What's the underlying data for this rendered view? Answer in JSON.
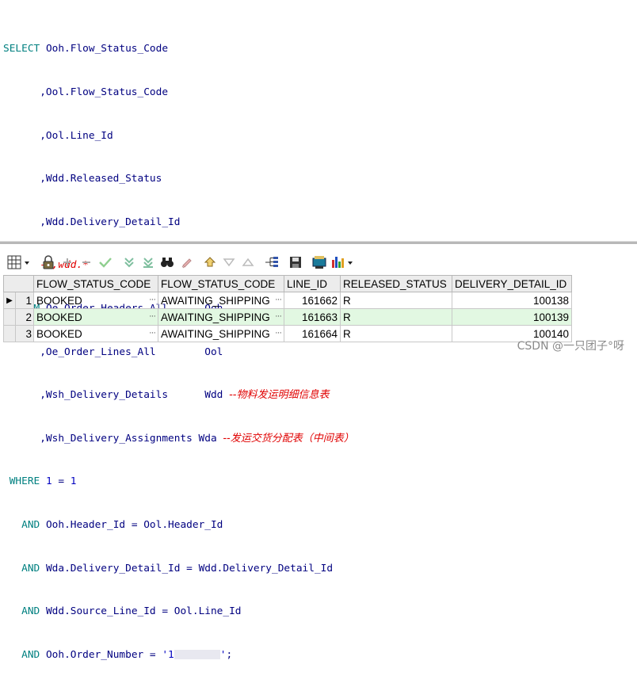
{
  "sql": {
    "l1_kw": "SELECT",
    "l1_rest": " Ooh.Flow_Status_Code",
    "l2": "      ,Ool.Flow_Status_Code",
    "l3": "      ,Ool.Line_Id",
    "l4": "      ,Wdd.Released_Status",
    "l5": "      ,Wdd.Delivery_Detail_Id",
    "l6_indent": "      ",
    "l6_cmt": "--,wdd.*",
    "l7_kw": "  FROM",
    "l7_rest": " Oe_Order_Headers_All      Ooh",
    "l8": "      ,Oe_Order_Lines_All        Ool",
    "l9": "      ,Wsh_Delivery_Details      Wdd ",
    "l9_cmt": "--物料发运明细信息表",
    "l10": "      ,Wsh_Delivery_Assignments Wda ",
    "l10_cmt": "--发运交货分配表（中间表）",
    "l11_kw": " WHERE",
    "l11_num1": "1",
    "l11_eq": " = ",
    "l11_num2": "1",
    "l12_kw": "AND",
    "l12_rest": " Ooh.Header_Id = Ool.Header_Id",
    "l13_kw": "AND",
    "l13_rest": " Wda.Delivery_Detail_Id = Wdd.Delivery_Detail_Id",
    "l14_kw": "AND",
    "l14_rest": " Wdd.Source_Line_Id = Ool.Line_Id",
    "l15_kw": "AND",
    "l15_rest": " Ooh.Order_Number = ",
    "l15_str1": "'1",
    "l15_str2": "'",
    "l15_end": ";"
  },
  "toolbar": {
    "icons": [
      "grid-menu-icon",
      "lock-icon",
      "add-record-icon",
      "delete-record-icon",
      "post-changes-icon",
      "query-filter-icon",
      "clear-filter-icon",
      "find-binoculars-icon",
      "clear-icon",
      "fetch-all-icon",
      "fetch-next-icon",
      "fetch-last-icon",
      "explain-plan-icon",
      "save-icon",
      "export-icon",
      "chart-icon"
    ]
  },
  "grid": {
    "columns": [
      "FLOW_STATUS_CODE",
      "FLOW_STATUS_CODE",
      "LINE_ID",
      "RELEASED_STATUS",
      "DELIVERY_DETAIL_ID"
    ],
    "rows": [
      {
        "num": "1",
        "c1": "BOOKED",
        "c2": "AWAITING_SHIPPING",
        "c3": "161662",
        "c4": "R",
        "c5": "100138"
      },
      {
        "num": "2",
        "c1": "BOOKED",
        "c2": "AWAITING_SHIPPING",
        "c3": "161663",
        "c4": "R",
        "c5": "100139"
      },
      {
        "num": "3",
        "c1": "BOOKED",
        "c2": "AWAITING_SHIPPING",
        "c3": "161664",
        "c4": "R",
        "c5": "100140"
      }
    ],
    "ellipsis": "···",
    "current_row_marker": "▶"
  },
  "watermark": "CSDN @一只团子°呀",
  "colors": {
    "keyword": "#008080",
    "identifier": "#000080",
    "comment": "#e00000",
    "selected_row": "#e2f8e2"
  }
}
